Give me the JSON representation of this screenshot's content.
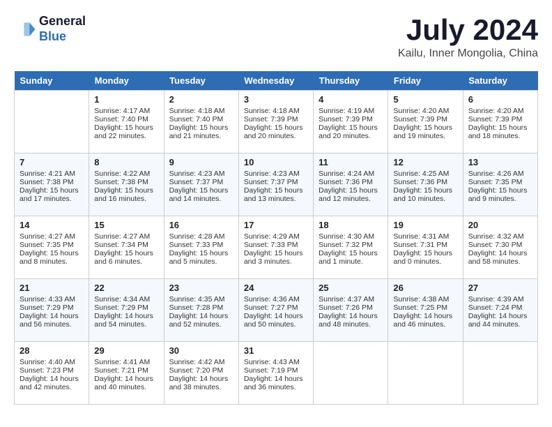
{
  "header": {
    "logo_line1": "General",
    "logo_line2": "Blue",
    "month": "July 2024",
    "location": "Kailu, Inner Mongolia, China"
  },
  "days_of_week": [
    "Sunday",
    "Monday",
    "Tuesday",
    "Wednesday",
    "Thursday",
    "Friday",
    "Saturday"
  ],
  "weeks": [
    [
      {
        "day": "",
        "info": ""
      },
      {
        "day": "1",
        "info": "Sunrise: 4:17 AM\nSunset: 7:40 PM\nDaylight: 15 hours\nand 22 minutes."
      },
      {
        "day": "2",
        "info": "Sunrise: 4:18 AM\nSunset: 7:40 PM\nDaylight: 15 hours\nand 21 minutes."
      },
      {
        "day": "3",
        "info": "Sunrise: 4:18 AM\nSunset: 7:39 PM\nDaylight: 15 hours\nand 20 minutes."
      },
      {
        "day": "4",
        "info": "Sunrise: 4:19 AM\nSunset: 7:39 PM\nDaylight: 15 hours\nand 20 minutes."
      },
      {
        "day": "5",
        "info": "Sunrise: 4:20 AM\nSunset: 7:39 PM\nDaylight: 15 hours\nand 19 minutes."
      },
      {
        "day": "6",
        "info": "Sunrise: 4:20 AM\nSunset: 7:39 PM\nDaylight: 15 hours\nand 18 minutes."
      }
    ],
    [
      {
        "day": "7",
        "info": "Sunrise: 4:21 AM\nSunset: 7:38 PM\nDaylight: 15 hours\nand 17 minutes."
      },
      {
        "day": "8",
        "info": "Sunrise: 4:22 AM\nSunset: 7:38 PM\nDaylight: 15 hours\nand 16 minutes."
      },
      {
        "day": "9",
        "info": "Sunrise: 4:23 AM\nSunset: 7:37 PM\nDaylight: 15 hours\nand 14 minutes."
      },
      {
        "day": "10",
        "info": "Sunrise: 4:23 AM\nSunset: 7:37 PM\nDaylight: 15 hours\nand 13 minutes."
      },
      {
        "day": "11",
        "info": "Sunrise: 4:24 AM\nSunset: 7:36 PM\nDaylight: 15 hours\nand 12 minutes."
      },
      {
        "day": "12",
        "info": "Sunrise: 4:25 AM\nSunset: 7:36 PM\nDaylight: 15 hours\nand 10 minutes."
      },
      {
        "day": "13",
        "info": "Sunrise: 4:26 AM\nSunset: 7:35 PM\nDaylight: 15 hours\nand 9 minutes."
      }
    ],
    [
      {
        "day": "14",
        "info": "Sunrise: 4:27 AM\nSunset: 7:35 PM\nDaylight: 15 hours\nand 8 minutes."
      },
      {
        "day": "15",
        "info": "Sunrise: 4:27 AM\nSunset: 7:34 PM\nDaylight: 15 hours\nand 6 minutes."
      },
      {
        "day": "16",
        "info": "Sunrise: 4:28 AM\nSunset: 7:33 PM\nDaylight: 15 hours\nand 5 minutes."
      },
      {
        "day": "17",
        "info": "Sunrise: 4:29 AM\nSunset: 7:33 PM\nDaylight: 15 hours\nand 3 minutes."
      },
      {
        "day": "18",
        "info": "Sunrise: 4:30 AM\nSunset: 7:32 PM\nDaylight: 15 hours\nand 1 minute."
      },
      {
        "day": "19",
        "info": "Sunrise: 4:31 AM\nSunset: 7:31 PM\nDaylight: 15 hours\nand 0 minutes."
      },
      {
        "day": "20",
        "info": "Sunrise: 4:32 AM\nSunset: 7:30 PM\nDaylight: 14 hours\nand 58 minutes."
      }
    ],
    [
      {
        "day": "21",
        "info": "Sunrise: 4:33 AM\nSunset: 7:29 PM\nDaylight: 14 hours\nand 56 minutes."
      },
      {
        "day": "22",
        "info": "Sunrise: 4:34 AM\nSunset: 7:29 PM\nDaylight: 14 hours\nand 54 minutes."
      },
      {
        "day": "23",
        "info": "Sunrise: 4:35 AM\nSunset: 7:28 PM\nDaylight: 14 hours\nand 52 minutes."
      },
      {
        "day": "24",
        "info": "Sunrise: 4:36 AM\nSunset: 7:27 PM\nDaylight: 14 hours\nand 50 minutes."
      },
      {
        "day": "25",
        "info": "Sunrise: 4:37 AM\nSunset: 7:26 PM\nDaylight: 14 hours\nand 48 minutes."
      },
      {
        "day": "26",
        "info": "Sunrise: 4:38 AM\nSunset: 7:25 PM\nDaylight: 14 hours\nand 46 minutes."
      },
      {
        "day": "27",
        "info": "Sunrise: 4:39 AM\nSunset: 7:24 PM\nDaylight: 14 hours\nand 44 minutes."
      }
    ],
    [
      {
        "day": "28",
        "info": "Sunrise: 4:40 AM\nSunset: 7:23 PM\nDaylight: 14 hours\nand 42 minutes."
      },
      {
        "day": "29",
        "info": "Sunrise: 4:41 AM\nSunset: 7:21 PM\nDaylight: 14 hours\nand 40 minutes."
      },
      {
        "day": "30",
        "info": "Sunrise: 4:42 AM\nSunset: 7:20 PM\nDaylight: 14 hours\nand 38 minutes."
      },
      {
        "day": "31",
        "info": "Sunrise: 4:43 AM\nSunset: 7:19 PM\nDaylight: 14 hours\nand 36 minutes."
      },
      {
        "day": "",
        "info": ""
      },
      {
        "day": "",
        "info": ""
      },
      {
        "day": "",
        "info": ""
      }
    ]
  ]
}
